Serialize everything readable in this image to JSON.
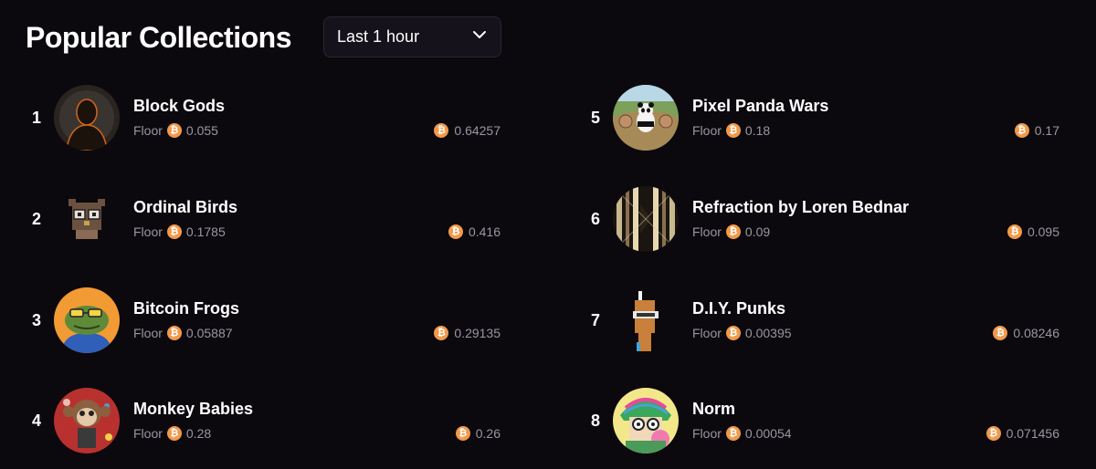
{
  "header": {
    "title": "Popular Collections",
    "timeframe": "Last 1 hour",
    "chevron_icon": "chevron-down-icon"
  },
  "currency_icon": "bitcoin-icon",
  "accent_color": "#f2994a",
  "collections": [
    {
      "rank": "1",
      "name": "Block Gods",
      "floor_label": "Floor",
      "floor": "0.055",
      "volume": "0.64257"
    },
    {
      "rank": "2",
      "name": "Ordinal Birds",
      "floor_label": "Floor",
      "floor": "0.1785",
      "volume": "0.416"
    },
    {
      "rank": "3",
      "name": "Bitcoin Frogs",
      "floor_label": "Floor",
      "floor": "0.05887",
      "volume": "0.29135"
    },
    {
      "rank": "4",
      "name": "Monkey Babies",
      "floor_label": "Floor",
      "floor": "0.28",
      "volume": "0.26"
    },
    {
      "rank": "5",
      "name": "Pixel Panda Wars",
      "floor_label": "Floor",
      "floor": "0.18",
      "volume": "0.17"
    },
    {
      "rank": "6",
      "name": "Refraction by Loren Bednar",
      "floor_label": "Floor",
      "floor": "0.09",
      "volume": "0.095"
    },
    {
      "rank": "7",
      "name": "D.I.Y. Punks",
      "floor_label": "Floor",
      "floor": "0.00395",
      "volume": "0.08246"
    },
    {
      "rank": "8",
      "name": "Norm",
      "floor_label": "Floor",
      "floor": "0.00054",
      "volume": "0.071456"
    }
  ]
}
